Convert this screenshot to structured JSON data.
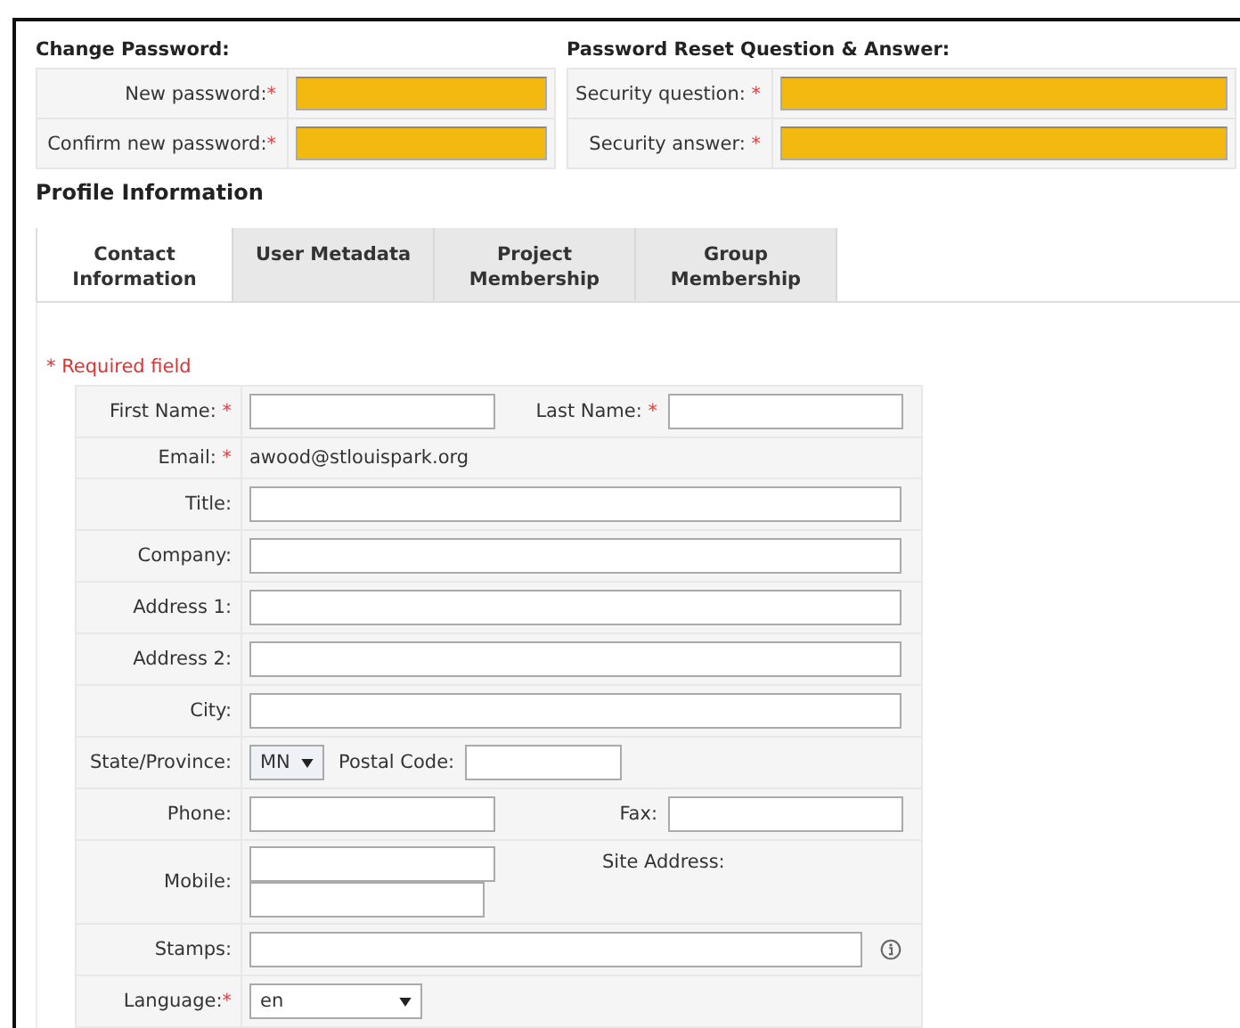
{
  "change_password": {
    "title": "Change Password:",
    "rows": [
      {
        "label": "New password:",
        "mark": "*"
      },
      {
        "label": "Confirm new password:",
        "mark": "*"
      }
    ]
  },
  "reset": {
    "title": "Password Reset Question & Answer:",
    "rows": [
      {
        "label": "Security question: ",
        "mark": "*"
      },
      {
        "label": "Security answer: ",
        "mark": "*"
      }
    ]
  },
  "profile": {
    "title": "Profile Information",
    "tabs": [
      {
        "label": "Contact Information",
        "selected": true
      },
      {
        "label": "User Metadata",
        "selected": false
      },
      {
        "label": "Project Membership",
        "selected": false
      },
      {
        "label": "Group Membership",
        "selected": false
      }
    ],
    "required_note": "* Required field",
    "rows": [
      {
        "kind": "split",
        "label": "First Name: ",
        "mark": "*",
        "label2": "Last Name: ",
        "mark2": "*"
      },
      {
        "kind": "value",
        "label": "Email: ",
        "mark": "*",
        "value": "awood@stlouispark.org"
      },
      {
        "kind": "input",
        "label": "Title:"
      },
      {
        "kind": "input",
        "label": "Company:"
      },
      {
        "kind": "input",
        "label": "Address 1:"
      },
      {
        "kind": "input",
        "label": "Address 2:"
      },
      {
        "kind": "input",
        "label": "City:"
      },
      {
        "kind": "select_postal",
        "label": "State/Province:",
        "value": "MN",
        "label2": "Postal Code:"
      },
      {
        "kind": "split",
        "label": "Phone:",
        "label2": "Fax:"
      },
      {
        "kind": "mobile",
        "label": "Mobile:",
        "label2": "Site Address:"
      },
      {
        "kind": "input_info",
        "label": "Stamps:"
      },
      {
        "kind": "select",
        "label": "Language:",
        "mark": "*",
        "value": "en"
      }
    ]
  }
}
